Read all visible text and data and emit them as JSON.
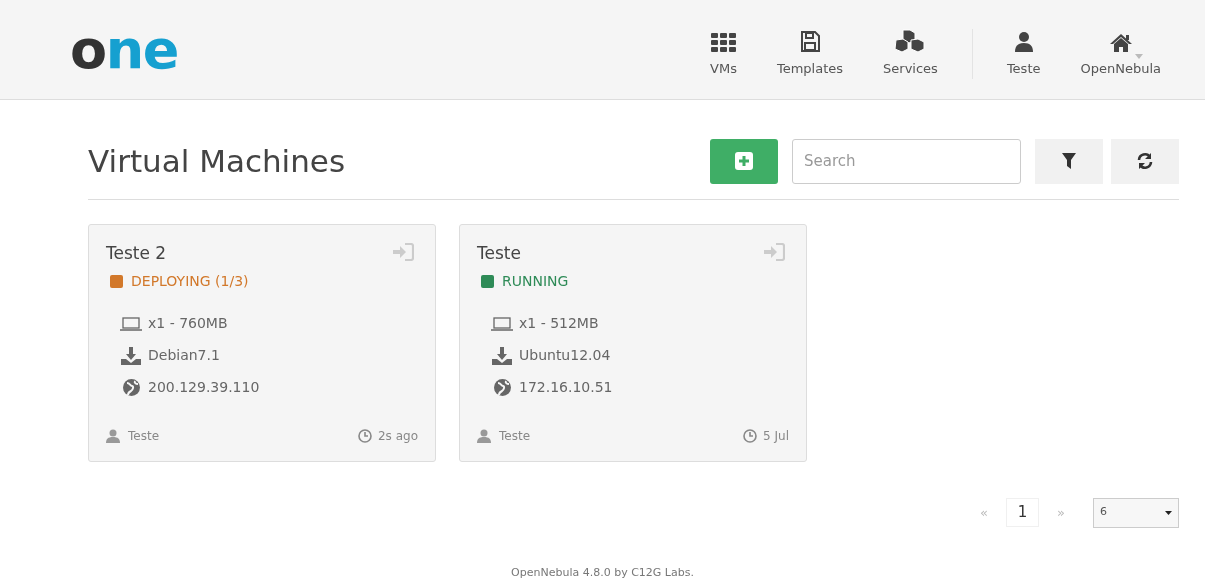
{
  "header": {
    "logo": [
      "o",
      "ne"
    ],
    "nav": [
      {
        "label": "VMs",
        "kind": "grid"
      },
      {
        "label": "Templates",
        "kind": "disk"
      },
      {
        "label": "Services",
        "kind": "cubes"
      },
      {
        "label": "Teste",
        "kind": "user"
      },
      {
        "label": "OpenNebula",
        "kind": "home",
        "dropdown": true
      }
    ]
  },
  "title": "Virtual Machines",
  "toolbar": {
    "search": {
      "placeholder": "Search"
    }
  },
  "vms": [
    {
      "name": "Teste 2",
      "state": "DEPLOYING (1/3)",
      "color": "#d2782a",
      "memory": "x1 - 760MB",
      "image": "Debian7.1",
      "ip": "200.129.39.110",
      "owner": "Teste",
      "time": "2s ago"
    },
    {
      "name": "Teste",
      "state": "RUNNING",
      "color": "#2e8b57",
      "memory": "x1 - 512MB",
      "image": "Ubuntu12.04",
      "ip": "172.16.10.51",
      "owner": "Teste",
      "time": "5 Jul"
    }
  ],
  "pagination": {
    "prev": "«",
    "pages": [
      {
        "label": "1",
        "selected": true
      }
    ],
    "next": "»",
    "page_size": "6"
  },
  "footer": "OpenNebula 4.8.0 by C12G Labs."
}
